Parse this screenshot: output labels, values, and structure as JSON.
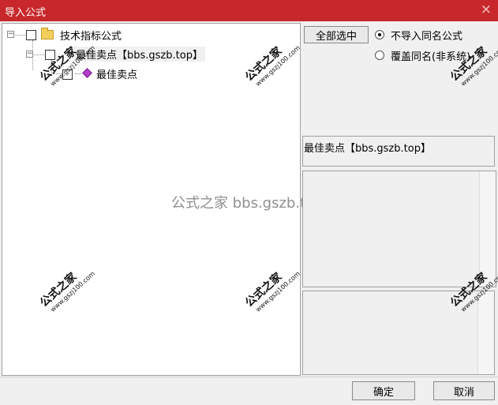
{
  "window": {
    "title": "导入公式",
    "close_label": "×"
  },
  "tree": {
    "root": {
      "label": "技术指标公式"
    },
    "child": {
      "label": "最佳卖点【bbs.gszb.top】"
    },
    "leaf": {
      "label": "最佳卖点"
    }
  },
  "options": {
    "select_all_label": "全部选中",
    "radio_skip_label": "不导入同名公式",
    "radio_overwrite_label": "覆盖同名(非系统)",
    "selected_option": "radio_skip"
  },
  "detail": {
    "formula_name": "最佳卖点【bbs.gszb.top】"
  },
  "footer": {
    "ok_label": "确定",
    "cancel_label": "取消"
  },
  "watermark": {
    "center_text": "公式之家 bbs.gszb.top",
    "stamp_title": "公式之家",
    "stamp_url": "www.gszj100.com"
  },
  "colors": {
    "titlebar": "#c8282c",
    "background": "#f0f0f0"
  }
}
